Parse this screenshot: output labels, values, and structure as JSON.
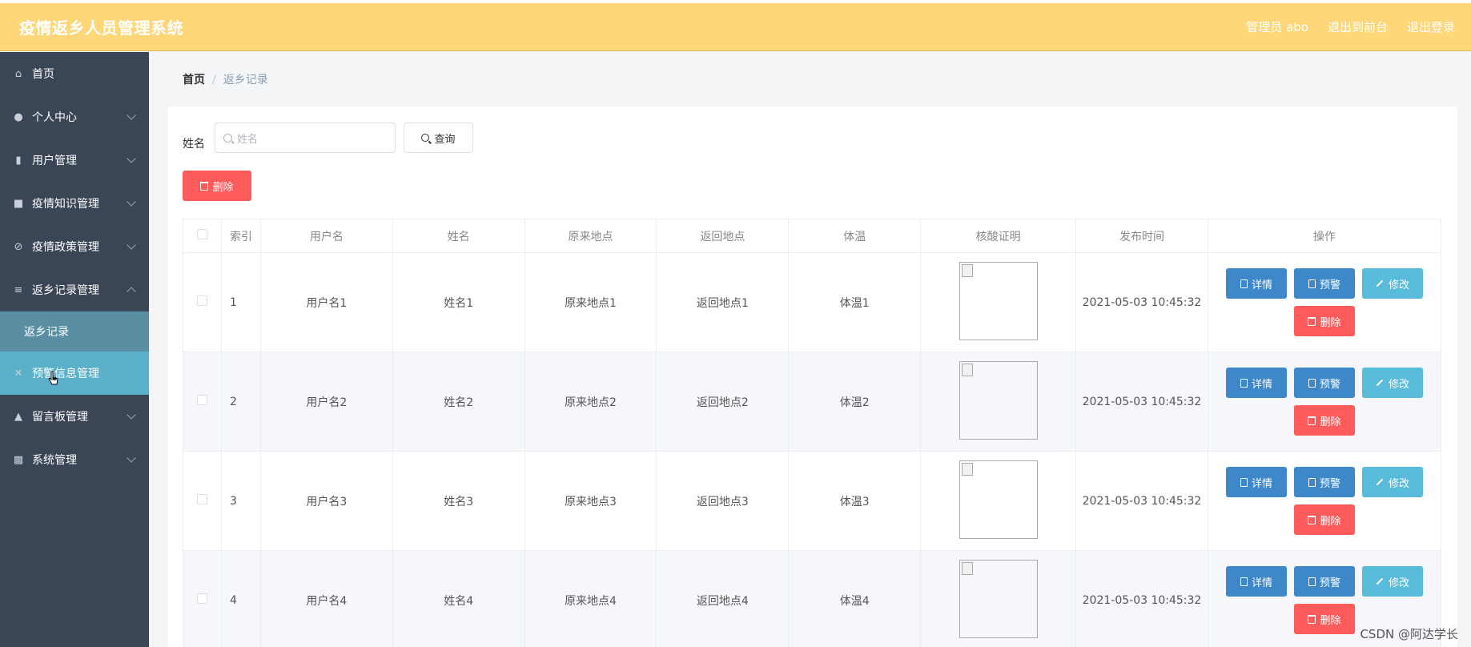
{
  "header": {
    "title": "疫情返乡人员管理系统",
    "admin": "管理员 abo",
    "to_front": "退出到前台",
    "logout": "退出登录"
  },
  "sidebar": {
    "items": [
      {
        "label": "首页",
        "icon": "home-icon"
      },
      {
        "label": "个人中心",
        "icon": "user-icon"
      },
      {
        "label": "用户管理",
        "icon": "phone-icon"
      },
      {
        "label": "疫情知识管理",
        "icon": "factory-icon"
      },
      {
        "label": "疫情政策管理",
        "icon": "flag-icon"
      },
      {
        "label": "返乡记录管理",
        "icon": "list-icon"
      },
      {
        "label": "返乡记录",
        "icon": ""
      },
      {
        "label": "预警信息管理",
        "icon": "cross-icon"
      },
      {
        "label": "留言板管理",
        "icon": "board-icon"
      },
      {
        "label": "系统管理",
        "icon": "chart-icon"
      }
    ]
  },
  "breadcrumb": {
    "home": "首页",
    "sep": "/",
    "current": "返乡记录"
  },
  "search": {
    "label": "姓名",
    "placeholder": "姓名",
    "button": "查询"
  },
  "toolbar": {
    "delete": "删除"
  },
  "table": {
    "headers": [
      "索引",
      "用户名",
      "姓名",
      "原来地点",
      "返回地点",
      "体温",
      "核酸证明",
      "发布时间",
      "操作"
    ],
    "rows": [
      {
        "idx": "1",
        "username": "用户名1",
        "name": "姓名1",
        "origin": "原来地点1",
        "dest": "返回地点1",
        "temp": "体温1",
        "time": "2021-05-03 10:45:32"
      },
      {
        "idx": "2",
        "username": "用户名2",
        "name": "姓名2",
        "origin": "原来地点2",
        "dest": "返回地点2",
        "temp": "体温2",
        "time": "2021-05-03 10:45:32"
      },
      {
        "idx": "3",
        "username": "用户名3",
        "name": "姓名3",
        "origin": "原来地点3",
        "dest": "返回地点3",
        "temp": "体温3",
        "time": "2021-05-03 10:45:32"
      },
      {
        "idx": "4",
        "username": "用户名4",
        "name": "姓名4",
        "origin": "原来地点4",
        "dest": "返回地点4",
        "temp": "体温4",
        "time": "2021-05-03 10:45:32"
      }
    ],
    "actions": {
      "detail": "详情",
      "warn": "预警",
      "edit": "修改",
      "delete": "删除"
    }
  },
  "watermark": "CSDN @阿达学长",
  "colors": {
    "header": "#ffd779",
    "sidebar": "#3a4556",
    "primary": "#3e87c9",
    "danger": "#ff5b5b",
    "info": "#58bbd9"
  }
}
